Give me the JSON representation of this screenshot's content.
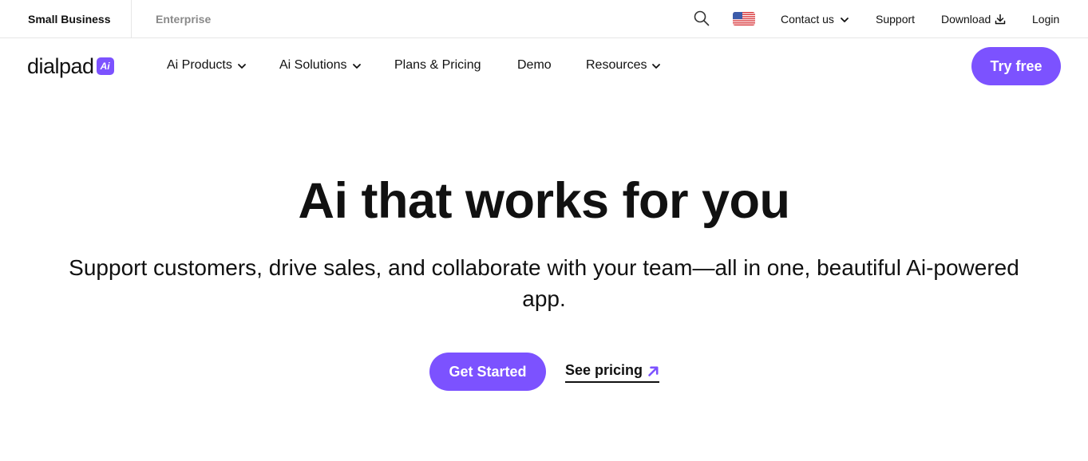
{
  "topbar": {
    "segments": [
      "Small Business",
      "Enterprise"
    ],
    "contact_label": "Contact us",
    "support_label": "Support",
    "download_label": "Download",
    "login_label": "Login"
  },
  "nav": {
    "logo_text": "dialpad",
    "logo_badge": "Ai",
    "items": [
      "Ai Products",
      "Ai Solutions",
      "Plans & Pricing",
      "Demo",
      "Resources"
    ],
    "cta_label": "Try free"
  },
  "hero": {
    "title": "Ai that works for you",
    "subtitle": "Support customers, drive sales, and collaborate with your team—all in one, beautiful Ai-powered app.",
    "primary_cta": "Get Started",
    "secondary_cta": "See pricing"
  },
  "colors": {
    "accent": "#7c52ff",
    "text": "#111111",
    "muted": "#8a8a8a",
    "border": "#e6e6e6"
  },
  "icons": {
    "search": "search-icon",
    "flag": "us-flag-icon",
    "chevron": "chevron-down-icon",
    "download": "download-icon",
    "arrow": "arrow-up-right-icon"
  }
}
